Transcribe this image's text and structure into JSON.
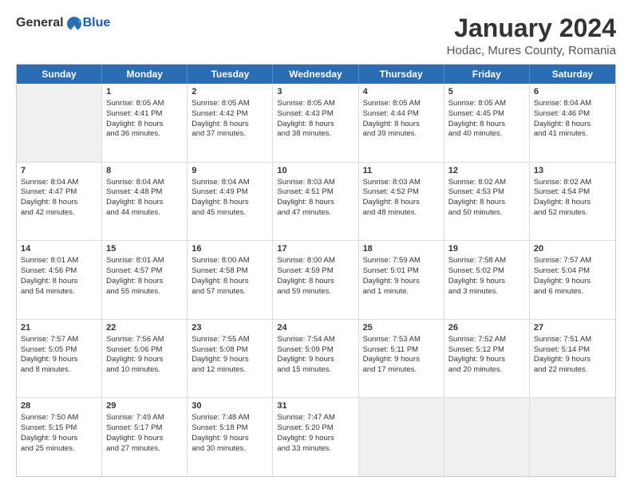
{
  "logo": {
    "general": "General",
    "blue": "Blue"
  },
  "title": "January 2024",
  "subtitle": "Hodac, Mures County, Romania",
  "days": [
    "Sunday",
    "Monday",
    "Tuesday",
    "Wednesday",
    "Thursday",
    "Friday",
    "Saturday"
  ],
  "rows": [
    [
      {
        "day": "",
        "empty": true
      },
      {
        "day": "1",
        "line1": "Sunrise: 8:05 AM",
        "line2": "Sunset: 4:41 PM",
        "line3": "Daylight: 8 hours",
        "line4": "and 36 minutes."
      },
      {
        "day": "2",
        "line1": "Sunrise: 8:05 AM",
        "line2": "Sunset: 4:42 PM",
        "line3": "Daylight: 8 hours",
        "line4": "and 37 minutes."
      },
      {
        "day": "3",
        "line1": "Sunrise: 8:05 AM",
        "line2": "Sunset: 4:43 PM",
        "line3": "Daylight: 8 hours",
        "line4": "and 38 minutes."
      },
      {
        "day": "4",
        "line1": "Sunrise: 8:05 AM",
        "line2": "Sunset: 4:44 PM",
        "line3": "Daylight: 8 hours",
        "line4": "and 39 minutes."
      },
      {
        "day": "5",
        "line1": "Sunrise: 8:05 AM",
        "line2": "Sunset: 4:45 PM",
        "line3": "Daylight: 8 hours",
        "line4": "and 40 minutes."
      },
      {
        "day": "6",
        "line1": "Sunrise: 8:04 AM",
        "line2": "Sunset: 4:46 PM",
        "line3": "Daylight: 8 hours",
        "line4": "and 41 minutes."
      }
    ],
    [
      {
        "day": "7",
        "line1": "Sunrise: 8:04 AM",
        "line2": "Sunset: 4:47 PM",
        "line3": "Daylight: 8 hours",
        "line4": "and 42 minutes."
      },
      {
        "day": "8",
        "line1": "Sunrise: 8:04 AM",
        "line2": "Sunset: 4:48 PM",
        "line3": "Daylight: 8 hours",
        "line4": "and 44 minutes."
      },
      {
        "day": "9",
        "line1": "Sunrise: 8:04 AM",
        "line2": "Sunset: 4:49 PM",
        "line3": "Daylight: 8 hours",
        "line4": "and 45 minutes."
      },
      {
        "day": "10",
        "line1": "Sunrise: 8:03 AM",
        "line2": "Sunset: 4:51 PM",
        "line3": "Daylight: 8 hours",
        "line4": "and 47 minutes."
      },
      {
        "day": "11",
        "line1": "Sunrise: 8:03 AM",
        "line2": "Sunset: 4:52 PM",
        "line3": "Daylight: 8 hours",
        "line4": "and 48 minutes."
      },
      {
        "day": "12",
        "line1": "Sunrise: 8:02 AM",
        "line2": "Sunset: 4:53 PM",
        "line3": "Daylight: 8 hours",
        "line4": "and 50 minutes."
      },
      {
        "day": "13",
        "line1": "Sunrise: 8:02 AM",
        "line2": "Sunset: 4:54 PM",
        "line3": "Daylight: 8 hours",
        "line4": "and 52 minutes."
      }
    ],
    [
      {
        "day": "14",
        "line1": "Sunrise: 8:01 AM",
        "line2": "Sunset: 4:56 PM",
        "line3": "Daylight: 8 hours",
        "line4": "and 54 minutes."
      },
      {
        "day": "15",
        "line1": "Sunrise: 8:01 AM",
        "line2": "Sunset: 4:57 PM",
        "line3": "Daylight: 8 hours",
        "line4": "and 55 minutes."
      },
      {
        "day": "16",
        "line1": "Sunrise: 8:00 AM",
        "line2": "Sunset: 4:58 PM",
        "line3": "Daylight: 8 hours",
        "line4": "and 57 minutes."
      },
      {
        "day": "17",
        "line1": "Sunrise: 8:00 AM",
        "line2": "Sunset: 4:59 PM",
        "line3": "Daylight: 8 hours",
        "line4": "and 59 minutes."
      },
      {
        "day": "18",
        "line1": "Sunrise: 7:59 AM",
        "line2": "Sunset: 5:01 PM",
        "line3": "Daylight: 9 hours",
        "line4": "and 1 minute."
      },
      {
        "day": "19",
        "line1": "Sunrise: 7:58 AM",
        "line2": "Sunset: 5:02 PM",
        "line3": "Daylight: 9 hours",
        "line4": "and 3 minutes."
      },
      {
        "day": "20",
        "line1": "Sunrise: 7:57 AM",
        "line2": "Sunset: 5:04 PM",
        "line3": "Daylight: 9 hours",
        "line4": "and 6 minutes."
      }
    ],
    [
      {
        "day": "21",
        "line1": "Sunrise: 7:57 AM",
        "line2": "Sunset: 5:05 PM",
        "line3": "Daylight: 9 hours",
        "line4": "and 8 minutes."
      },
      {
        "day": "22",
        "line1": "Sunrise: 7:56 AM",
        "line2": "Sunset: 5:06 PM",
        "line3": "Daylight: 9 hours",
        "line4": "and 10 minutes."
      },
      {
        "day": "23",
        "line1": "Sunrise: 7:55 AM",
        "line2": "Sunset: 5:08 PM",
        "line3": "Daylight: 9 hours",
        "line4": "and 12 minutes."
      },
      {
        "day": "24",
        "line1": "Sunrise: 7:54 AM",
        "line2": "Sunset: 5:09 PM",
        "line3": "Daylight: 9 hours",
        "line4": "and 15 minutes."
      },
      {
        "day": "25",
        "line1": "Sunrise: 7:53 AM",
        "line2": "Sunset: 5:11 PM",
        "line3": "Daylight: 9 hours",
        "line4": "and 17 minutes."
      },
      {
        "day": "26",
        "line1": "Sunrise: 7:52 AM",
        "line2": "Sunset: 5:12 PM",
        "line3": "Daylight: 9 hours",
        "line4": "and 20 minutes."
      },
      {
        "day": "27",
        "line1": "Sunrise: 7:51 AM",
        "line2": "Sunset: 5:14 PM",
        "line3": "Daylight: 9 hours",
        "line4": "and 22 minutes."
      }
    ],
    [
      {
        "day": "28",
        "line1": "Sunrise: 7:50 AM",
        "line2": "Sunset: 5:15 PM",
        "line3": "Daylight: 9 hours",
        "line4": "and 25 minutes."
      },
      {
        "day": "29",
        "line1": "Sunrise: 7:49 AM",
        "line2": "Sunset: 5:17 PM",
        "line3": "Daylight: 9 hours",
        "line4": "and 27 minutes."
      },
      {
        "day": "30",
        "line1": "Sunrise: 7:48 AM",
        "line2": "Sunset: 5:18 PM",
        "line3": "Daylight: 9 hours",
        "line4": "and 30 minutes."
      },
      {
        "day": "31",
        "line1": "Sunrise: 7:47 AM",
        "line2": "Sunset: 5:20 PM",
        "line3": "Daylight: 9 hours",
        "line4": "and 33 minutes."
      },
      {
        "day": "",
        "empty": true
      },
      {
        "day": "",
        "empty": true
      },
      {
        "day": "",
        "empty": true
      }
    ]
  ]
}
